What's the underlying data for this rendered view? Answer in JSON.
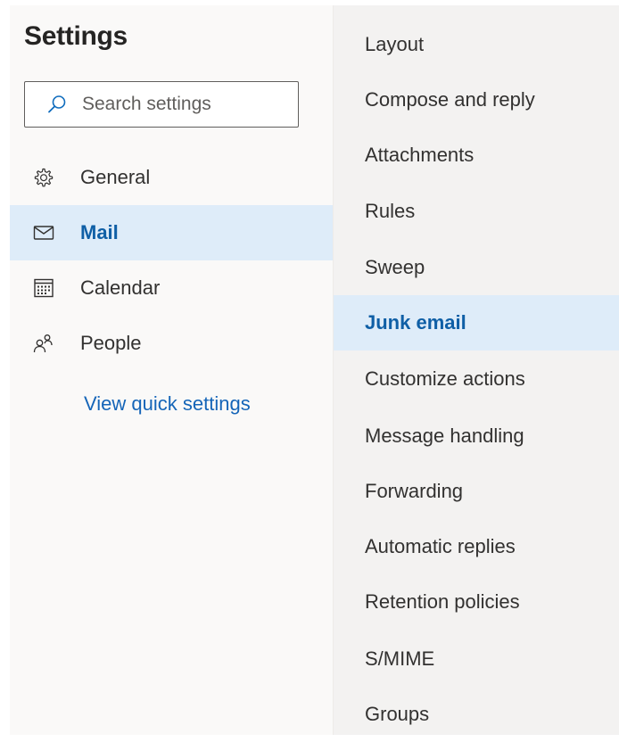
{
  "header": {
    "title": "Settings"
  },
  "search": {
    "placeholder": "Search settings",
    "icon": "search-icon"
  },
  "nav": {
    "items": [
      {
        "label": "General",
        "icon": "gear-icon",
        "selected": false
      },
      {
        "label": "Mail",
        "icon": "mail-icon",
        "selected": true
      },
      {
        "label": "Calendar",
        "icon": "calendar-icon",
        "selected": false
      },
      {
        "label": "People",
        "icon": "people-icon",
        "selected": false
      }
    ],
    "quick_settings_link": "View quick settings"
  },
  "mail_settings": {
    "items": [
      {
        "label": "Layout",
        "selected": false
      },
      {
        "label": "Compose and reply",
        "selected": false
      },
      {
        "label": "Attachments",
        "selected": false
      },
      {
        "label": "Rules",
        "selected": false
      },
      {
        "label": "Sweep",
        "selected": false
      },
      {
        "label": "Junk email",
        "selected": true
      },
      {
        "label": "Customize actions",
        "selected": false
      },
      {
        "label": "Message handling",
        "selected": false
      },
      {
        "label": "Forwarding",
        "selected": false
      },
      {
        "label": "Automatic replies",
        "selected": false
      },
      {
        "label": "Retention policies",
        "selected": false
      },
      {
        "label": "S/MIME",
        "selected": false
      },
      {
        "label": "Groups",
        "selected": false
      }
    ]
  },
  "colors": {
    "selected_background": "#deecf9",
    "selected_text": "#0f5fa6",
    "link": "#1565b8",
    "left_pane_bg": "#faf9f8",
    "right_pane_bg": "#f3f2f1"
  }
}
